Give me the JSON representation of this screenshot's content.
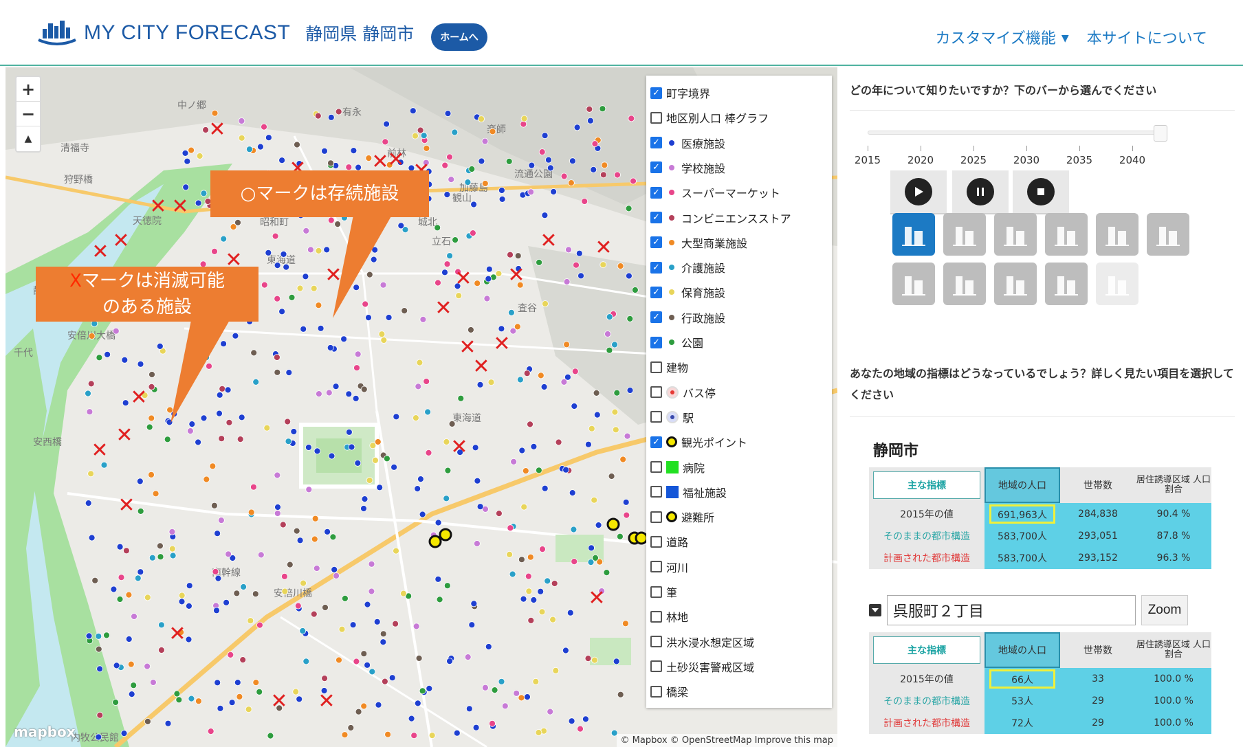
{
  "header": {
    "brand": "MY CITY FORECAST",
    "city": "静岡県 静岡市",
    "home_button": "ホームへ",
    "nav": {
      "customize": "カスタマイズ機能",
      "about": "本サイトについて"
    }
  },
  "map": {
    "zoom_in": "+",
    "zoom_out": "−",
    "compass": "▲",
    "callout_keep": "○マークは存続施設",
    "callout_vanish_x": "X",
    "callout_vanish_text1": "マークは消滅可能",
    "callout_vanish_text2": "のある施設",
    "logo": "mapbox",
    "attribution": "© Mapbox © OpenStreetMap  Improve this map",
    "place_labels": [
      "中ノ郷",
      "有永",
      "前林",
      "楽師",
      "流通公園",
      "加藤島",
      "昭和町",
      "城北",
      "立石",
      "観山",
      "安倍川大橋",
      "安西橋",
      "静岡斎場",
      "査谷",
      "東海道",
      "南幹線",
      "安倍川橋",
      "内牧公民館",
      "清福寺",
      "狩野橋",
      "天徳院",
      "東海道",
      "千代"
    ],
    "layers": [
      {
        "label": "町字境界",
        "checked": true,
        "swatch": "none",
        "color": ""
      },
      {
        "label": "地区別人口 棒グラフ",
        "checked": false,
        "swatch": "none",
        "color": ""
      },
      {
        "label": "医療施設",
        "checked": true,
        "swatch": "dot",
        "color": "#1e3fd1"
      },
      {
        "label": "学校施設",
        "checked": true,
        "swatch": "dot",
        "color": "#c77ad6"
      },
      {
        "label": "スーパーマーケット",
        "checked": true,
        "swatch": "dot",
        "color": "#e8458a"
      },
      {
        "label": "コンビニエンスストア",
        "checked": true,
        "swatch": "dot",
        "color": "#b4405a"
      },
      {
        "label": "大型商業施設",
        "checked": true,
        "swatch": "dot",
        "color": "#f08a24"
      },
      {
        "label": "介護施設",
        "checked": true,
        "swatch": "dot",
        "color": "#29a0c8"
      },
      {
        "label": "保育施設",
        "checked": true,
        "swatch": "dot",
        "color": "#e8d55a"
      },
      {
        "label": "行政施設",
        "checked": true,
        "swatch": "dot",
        "color": "#6e5e52"
      },
      {
        "label": "公園",
        "checked": true,
        "swatch": "dot",
        "color": "#2e9c3e"
      },
      {
        "label": "建物",
        "checked": false,
        "swatch": "none",
        "color": ""
      },
      {
        "label": "バス停",
        "checked": false,
        "swatch": "bus",
        "color": "#e53935"
      },
      {
        "label": "駅",
        "checked": false,
        "swatch": "st",
        "color": "#3949ab"
      },
      {
        "label": "観光ポイント",
        "checked": true,
        "swatch": "ring",
        "color": "#f5e800"
      },
      {
        "label": "病院",
        "checked": false,
        "swatch": "square",
        "color": "#22e022"
      },
      {
        "label": "福祉施設",
        "checked": false,
        "swatch": "square",
        "color": "#1456d8"
      },
      {
        "label": "避難所",
        "checked": false,
        "swatch": "ring",
        "color": "#f5e800"
      },
      {
        "label": "道路",
        "checked": false,
        "swatch": "none",
        "color": ""
      },
      {
        "label": "河川",
        "checked": false,
        "swatch": "none",
        "color": ""
      },
      {
        "label": "筆",
        "checked": false,
        "swatch": "none",
        "color": ""
      },
      {
        "label": "林地",
        "checked": false,
        "swatch": "none",
        "color": ""
      },
      {
        "label": "洪水浸水想定区域",
        "checked": false,
        "swatch": "none",
        "color": ""
      },
      {
        "label": "土砂災害警戒区域",
        "checked": false,
        "swatch": "none",
        "color": ""
      },
      {
        "label": "橋梁",
        "checked": false,
        "swatch": "none",
        "color": ""
      }
    ]
  },
  "panel": {
    "year_question": "どの年について知りたいですか？下のバーから選んでください",
    "years": [
      "2015",
      "2020",
      "2025",
      "2030",
      "2035",
      "2040"
    ],
    "selected_year": "2040",
    "controls": [
      "play",
      "pause",
      "stop"
    ],
    "categories": [
      {
        "icon": "town-icon",
        "state": "active"
      },
      {
        "icon": "bus-icon",
        "state": "off"
      },
      {
        "icon": "medical-icon",
        "state": "off"
      },
      {
        "icon": "people-icon",
        "state": "off"
      },
      {
        "icon": "buildings-icon",
        "state": "off"
      },
      {
        "icon": "hospital-icon",
        "state": "off"
      },
      {
        "icon": "house-icon",
        "state": "off"
      },
      {
        "icon": "road-icon",
        "state": "off"
      },
      {
        "icon": "care-icon",
        "state": "off"
      },
      {
        "icon": "farmland-icon",
        "state": "off"
      },
      {
        "icon": "chart-icon",
        "state": "dim"
      }
    ],
    "indicator_question": "あなたの地域の指標はどうなっているでしょう？詳しく見たい項目を選択してください",
    "city_title": "静岡市",
    "city_table": {
      "headers": [
        "主な指標",
        "地域の人口",
        "世帯数",
        "居住誘導区域 人口割合"
      ],
      "rows": [
        {
          "label": "2015年の値",
          "pop": "691,963人",
          "hh": "284,838",
          "ratio": "90.4 %"
        },
        {
          "label": "そのままの都市構造",
          "pop": "583,700人",
          "hh": "293,051",
          "ratio": "87.8 %"
        },
        {
          "label": "計画された都市構造",
          "pop": "583,700人",
          "hh": "293,152",
          "ratio": "96.3 %"
        }
      ]
    },
    "town_input": "呉服町２丁目",
    "zoom_button": "Zoom",
    "town_table": {
      "headers": [
        "主な指標",
        "地域の人口",
        "世帯数",
        "居住誘導区域 人口割合"
      ],
      "rows": [
        {
          "label": "2015年の値",
          "pop": "66人",
          "hh": "33",
          "ratio": "100.0 %"
        },
        {
          "label": "そのままの都市構造",
          "pop": "53人",
          "hh": "29",
          "ratio": "100.0 %"
        },
        {
          "label": "計画された都市構造",
          "pop": "72人",
          "hh": "29",
          "ratio": "100.0 %"
        }
      ]
    }
  }
}
